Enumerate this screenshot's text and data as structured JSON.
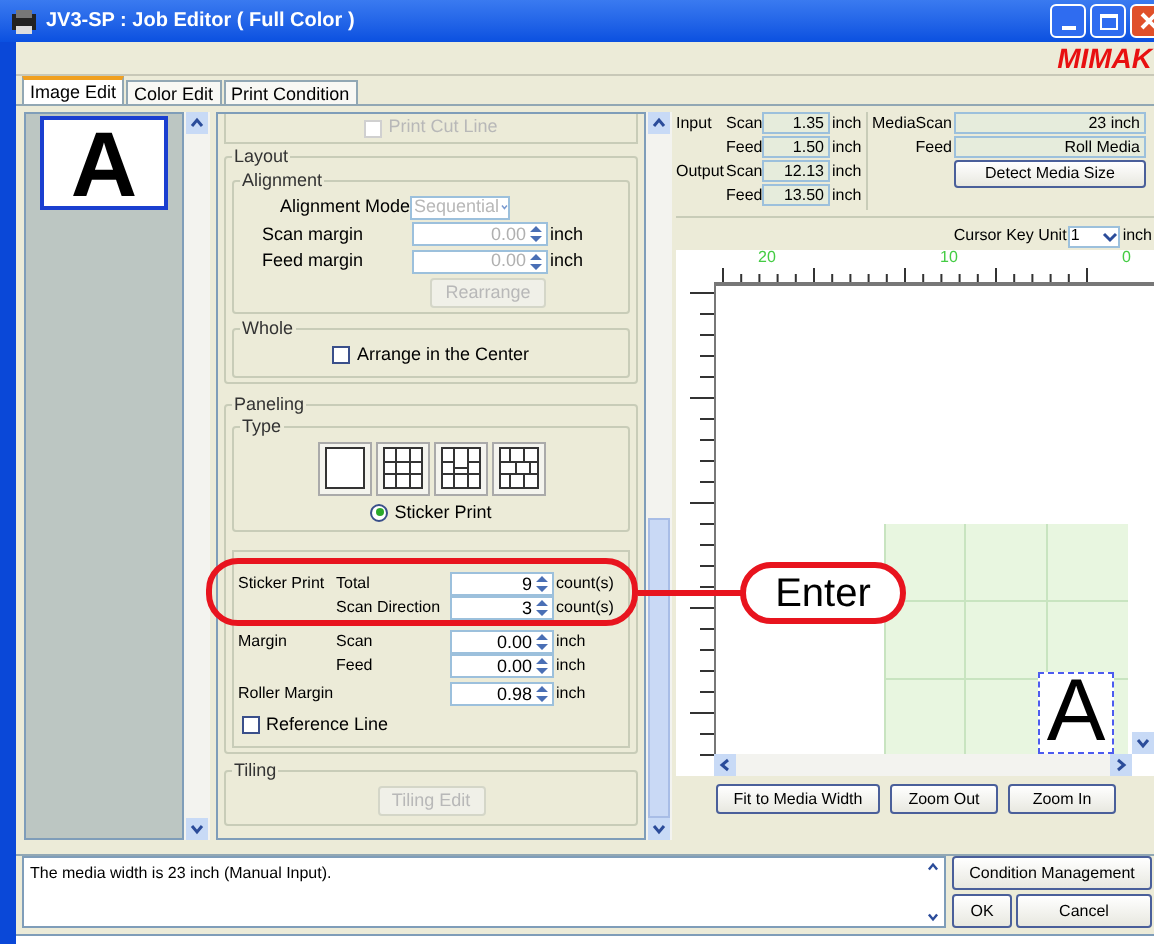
{
  "window": {
    "title": "JV3-SP : Job Editor ( Full Color )",
    "logo": "MIMAK"
  },
  "tabs": [
    {
      "label": "Image Edit",
      "selected": true
    },
    {
      "label": "Color Edit",
      "selected": false
    },
    {
      "label": "Print Condition",
      "selected": false
    }
  ],
  "thumbnail": {
    "letter": "A"
  },
  "options": {
    "print_cut_line": {
      "label": "Print Cut Line",
      "checked": false,
      "disabled": true
    },
    "layout": {
      "title": "Layout",
      "alignment": {
        "title": "Alignment",
        "mode_label": "Alignment Mode",
        "mode": "Sequential",
        "disabled": true,
        "fields": [
          {
            "label": "Scan margin",
            "value": "0.00",
            "unit": "inch"
          },
          {
            "label": "Feed margin",
            "value": "0.00",
            "unit": "inch"
          }
        ],
        "button": "Rearrange"
      },
      "whole": {
        "title": "Whole",
        "label": "Arrange in the Center",
        "checked": false
      }
    },
    "paneling": {
      "title": "Paneling",
      "type_title": "Type",
      "types": [
        {
          "kind": "single"
        },
        {
          "kind": "grid"
        },
        {
          "kind": "mixed"
        },
        {
          "kind": "brick"
        }
      ],
      "radio": {
        "label": "Sticker Print",
        "selected": true
      },
      "rows": [
        {
          "label": "Sticker Print",
          "sublabel": "Total",
          "value": "9",
          "unit": "count(s)"
        },
        {
          "sublabel": "Scan Direction",
          "value": "3",
          "unit": "count(s)"
        },
        {
          "label": "Margin",
          "sublabel": "Scan",
          "value": "0.00",
          "unit": "inch"
        },
        {
          "sublabel": "Feed",
          "value": "0.00",
          "unit": "inch"
        },
        {
          "label": "Roller Margin",
          "value": "0.98",
          "unit": "inch"
        }
      ],
      "reference_line": {
        "label": "Reference Line",
        "checked": false
      }
    },
    "tiling": {
      "title": "Tiling",
      "button": "Tiling Edit",
      "disabled": true
    }
  },
  "sizes": [
    {
      "group": "Input",
      "label": "Scan",
      "value": "1.35",
      "unit": "inch"
    },
    {
      "label": "Feed",
      "value": "1.50",
      "unit": "inch"
    },
    {
      "group": "Output",
      "label": "Scan",
      "value": "12.13",
      "unit": "inch"
    },
    {
      "label": "Feed",
      "value": "13.50",
      "unit": "inch"
    }
  ],
  "media": [
    {
      "group": "Media",
      "label": "Scan",
      "value": "23 inch"
    },
    {
      "label": "Feed",
      "value": "Roll Media"
    }
  ],
  "detect_button": "Detect Media Size",
  "cursor_key": {
    "label": "Cursor Key Unit",
    "value": "1",
    "unit": "inch"
  },
  "ruler": {
    "labels": [
      "20",
      "10",
      "0"
    ]
  },
  "canvas": {
    "letter": "A"
  },
  "view_buttons": [
    "Fit to Media Width",
    "Zoom Out",
    "Zoom In"
  ],
  "message": "The media width is 23 inch (Manual Input).",
  "condition_button": "Condition Management",
  "dialog_buttons": [
    "OK",
    "Cancel"
  ],
  "callout": {
    "label": "Enter"
  }
}
